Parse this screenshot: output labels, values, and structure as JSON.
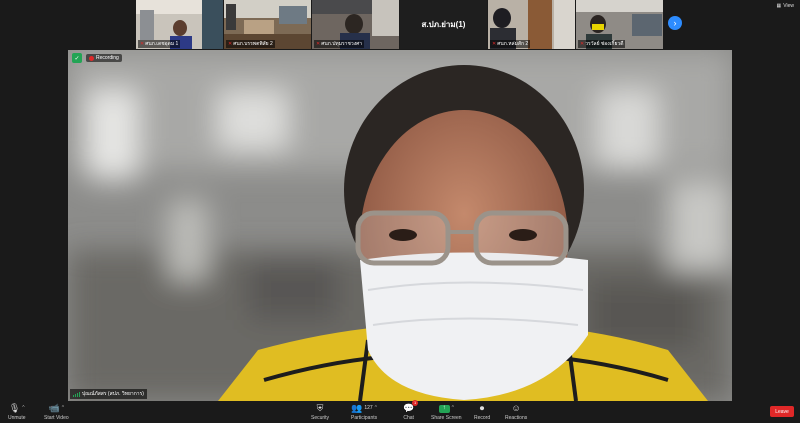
{
  "gallery": {
    "tiles": [
      {
        "name": "ศบภ.เดชอุดม 1",
        "muted": true
      },
      {
        "name": "ศบภ.บรรพตพิสัย 2",
        "muted": true
      },
      {
        "name": "ศบภ.ปทุมราชวงศา",
        "muted": true
      },
      {
        "name": "ส.ปภ.ย่าม(1)",
        "muted": false
      },
      {
        "name": "ศบภ.หล่มสัก 2",
        "muted": true
      },
      {
        "name": "วรวัลย์ ช่องเกิ้ยวดี",
        "muted": true
      }
    ],
    "next_icon": "chevron-right-icon",
    "view_label": "View"
  },
  "main": {
    "recording_label": "Recording",
    "speaker_name": "ปุณณ์ภัสสร (สปภ. วิทยาการ)"
  },
  "toolbar": {
    "unmute": "Unmute",
    "start_video": "Start Video",
    "security": "Security",
    "participants": "Participants",
    "participants_count": "127",
    "chat": "Chat",
    "chat_badge": "1",
    "share_screen": "Share Screen",
    "record": "Record",
    "reactions": "Reactions",
    "leave": "Leave"
  },
  "colors": {
    "accent_blue": "#2d8cff",
    "share_green": "#23a455",
    "leave_red": "#e02828"
  }
}
